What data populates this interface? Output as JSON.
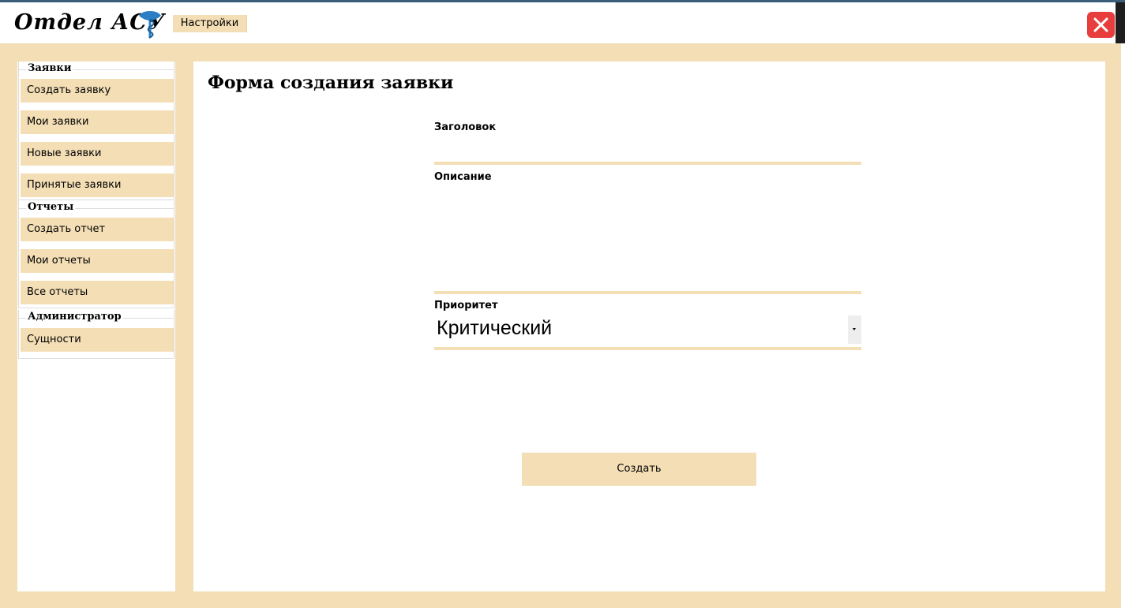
{
  "header": {
    "title": "Отдел АСУ",
    "settings_label": "Настройки"
  },
  "sidebar": {
    "groups": [
      {
        "title": "Заявки",
        "items": [
          {
            "label": "Создать заявку"
          },
          {
            "label": "Мои заявки"
          },
          {
            "label": "Новые заявки"
          },
          {
            "label": "Принятые заявки"
          }
        ]
      },
      {
        "title": "Отчеты",
        "items": [
          {
            "label": "Создать отчет"
          },
          {
            "label": "Мои отчеты"
          },
          {
            "label": "Все отчеты"
          }
        ]
      },
      {
        "title": "Администратор",
        "items": [
          {
            "label": "Сущности"
          }
        ]
      }
    ]
  },
  "main": {
    "title": "Форма создания заявки",
    "form": {
      "title_label": "Заголовок",
      "title_value": "",
      "description_label": "Описание",
      "description_value": "",
      "priority_label": "Приоритет",
      "priority_value": "Критический",
      "submit_label": "Создать"
    }
  },
  "colors": {
    "accent": "#f3deb5",
    "close": "#e83d3d",
    "panel": "#ffffff"
  },
  "icons": {
    "logo": "medical-bowl-snake-icon",
    "close": "close-icon",
    "dropdown": "chevron-down-icon"
  }
}
